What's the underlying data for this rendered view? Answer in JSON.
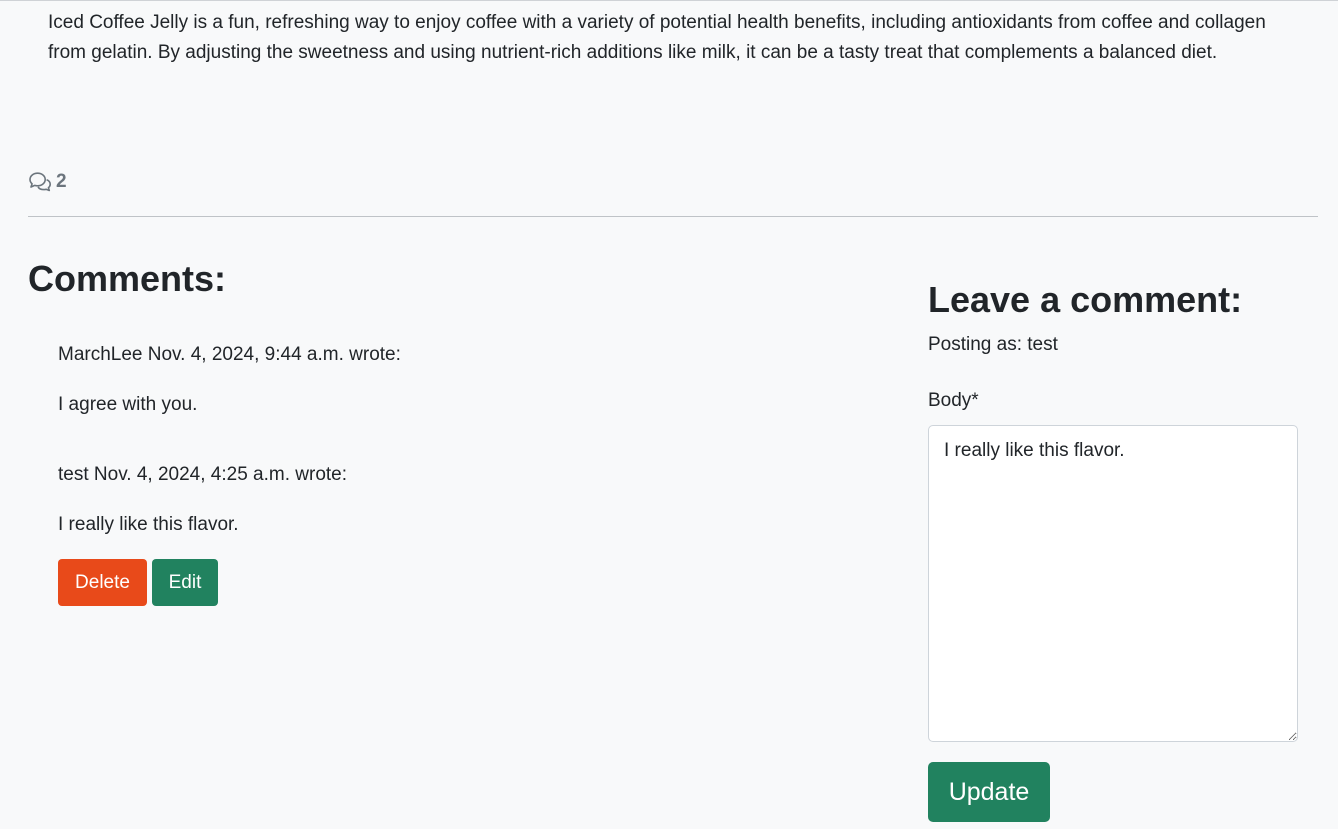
{
  "post": {
    "body": "Iced Coffee Jelly is a fun, refreshing way to enjoy coffee with a variety of potential health benefits, including antioxidants from coffee and collagen from gelatin. By adjusting the sweetness and using nutrient-rich additions like milk, it can be a tasty treat that complements a balanced diet.",
    "comment_count": "2",
    "comment_icon": "chat-bubbles-icon"
  },
  "comments": {
    "title": "Comments:",
    "items": [
      {
        "meta": "MarchLee Nov. 4, 2024, 9:44 a.m. wrote:",
        "text": "I agree with you."
      },
      {
        "meta": "test Nov. 4, 2024, 4:25 a.m. wrote:",
        "text": "I really like this flavor."
      }
    ],
    "delete_label": "Delete",
    "edit_label": "Edit"
  },
  "form": {
    "title": "Leave a comment:",
    "posting_as": "Posting as: test",
    "body_label": "Body*",
    "body_value": "I really like this flavor.",
    "submit_label": "Update"
  },
  "colors": {
    "delete": "#e84a1a",
    "edit": "#21825f",
    "update": "#21825f",
    "background": "#f8f9fa"
  }
}
